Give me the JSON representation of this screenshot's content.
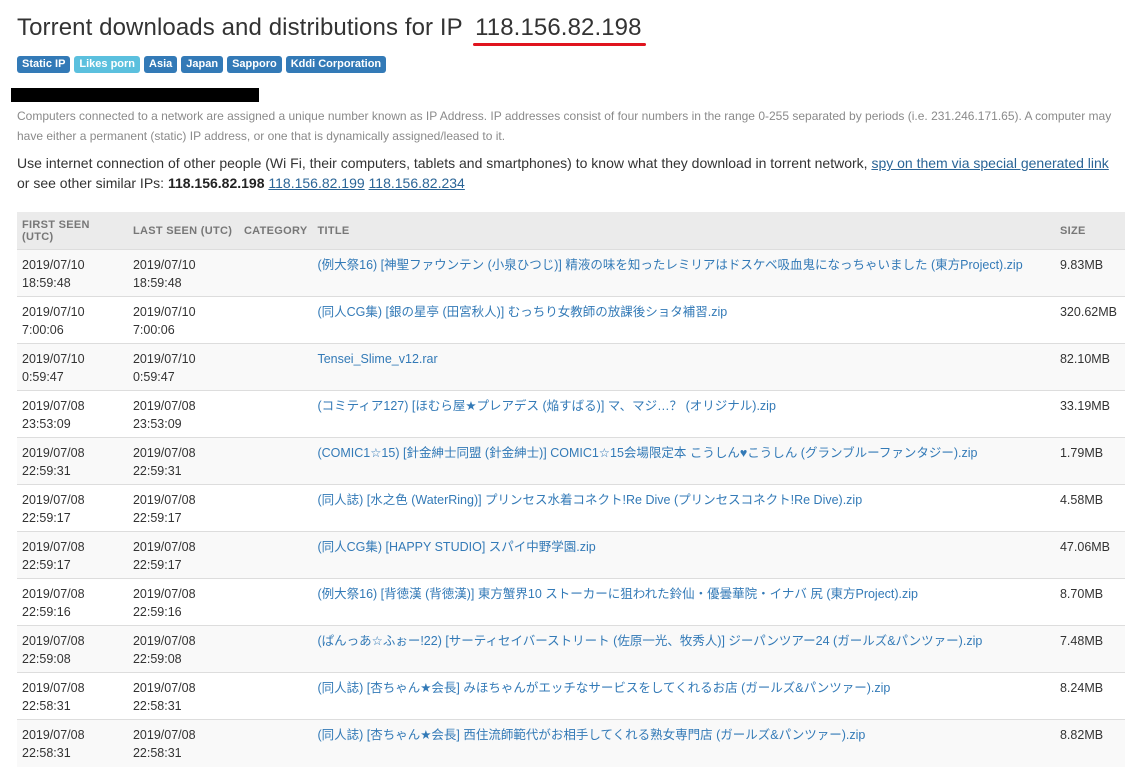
{
  "header": {
    "title_prefix": "Torrent downloads and distributions for IP",
    "ip": "118.156.82.198"
  },
  "tags": [
    {
      "label": "Static IP",
      "style": "primary"
    },
    {
      "label": "Likes porn",
      "style": "light"
    },
    {
      "label": "Asia",
      "style": "primary"
    },
    {
      "label": "Japan",
      "style": "primary"
    },
    {
      "label": "Sapporo",
      "style": "primary"
    },
    {
      "label": "Kddi Corporation",
      "style": "primary"
    }
  ],
  "note": "Computers connected to a network are assigned a unique number known as IP Address. IP addresses consist of four numbers in the range 0-255 separated by periods (i.e. 231.246.171.65). A computer may have either a permanent (static) IP address, or one that is dynamically assigned/leased to it.",
  "intro": {
    "text1": "Use internet connection of other people (Wi Fi, their computers, tablets and smartphones) to know what they download in torrent network, ",
    "spy_link": "spy on them via special generated link",
    "text2": "or see other similar IPs: ",
    "current_ip": "118.156.82.198",
    "similar_ips": [
      "118.156.82.199",
      "118.156.82.234"
    ]
  },
  "table": {
    "headers": [
      "First seen (UTC)",
      "Last seen (UTC)",
      "Category",
      "Title",
      "Size"
    ],
    "rows": [
      {
        "first": "2019/07/10 18:59:48",
        "last": "2019/07/10 18:59:48",
        "category": "",
        "title": "(例大祭16) [神聖ファウンテン (小泉ひつじ)] 精液の味を知ったレミリアはドスケベ吸血鬼になっちゃいました (東方Project).zip",
        "size": "9.83MB"
      },
      {
        "first": "2019/07/10 7:00:06",
        "last": "2019/07/10 7:00:06",
        "category": "",
        "title": "(同人CG集) [銀の星亭 (田宮秋人)] むっちり女教師の放課後ショタ補習.zip",
        "size": "320.62MB"
      },
      {
        "first": "2019/07/10 0:59:47",
        "last": "2019/07/10 0:59:47",
        "category": "",
        "title": "Tensei_Slime_v12.rar",
        "size": "82.10MB"
      },
      {
        "first": "2019/07/08 23:53:09",
        "last": "2019/07/08 23:53:09",
        "category": "",
        "title": "(コミティア127) [ほむら屋★プレアデス (焔すばる)] マ、マジ…？ (オリジナル).zip",
        "size": "33.19MB"
      },
      {
        "first": "2019/07/08 22:59:31",
        "last": "2019/07/08 22:59:31",
        "category": "",
        "title": "(COMIC1☆15) [針金紳士同盟 (針金紳士)] COMIC1☆15会場限定本 こうしん♥こうしん (グランブルーファンタジー).zip",
        "size": "1.79MB"
      },
      {
        "first": "2019/07/08 22:59:17",
        "last": "2019/07/08 22:59:17",
        "category": "",
        "title": "(同人誌) [水之色 (WaterRing)] プリンセス水着コネクト!Re Dive (プリンセスコネクト!Re Dive).zip",
        "size": "4.58MB"
      },
      {
        "first": "2019/07/08 22:59:17",
        "last": "2019/07/08 22:59:17",
        "category": "",
        "title": "(同人CG集) [HAPPY STUDIO] スパイ中野学園.zip",
        "size": "47.06MB"
      },
      {
        "first": "2019/07/08 22:59:16",
        "last": "2019/07/08 22:59:16",
        "category": "",
        "title": "(例大祭16) [背徳漢 (背徳漢)] 東方蟹界10 ストーカーに狙われた鈴仙・優曇華院・イナバ 尻 (東方Project).zip",
        "size": "8.70MB"
      },
      {
        "first": "2019/07/08 22:59:08",
        "last": "2019/07/08 22:59:08",
        "category": "",
        "title": "(ぱんっあ☆ふぉー!22) [サーティセイバーストリート (佐原一光、牧秀人)] ジーパンツアー24 (ガールズ&パンツァー).zip",
        "size": "7.48MB"
      },
      {
        "first": "2019/07/08 22:58:31",
        "last": "2019/07/08 22:58:31",
        "category": "",
        "title": "(同人誌) [杏ちゃん★会長] みほちゃんがエッチなサービスをしてくれるお店 (ガールズ&パンツァー).zip",
        "size": "8.24MB"
      },
      {
        "first": "2019/07/08 22:58:31",
        "last": "2019/07/08 22:58:31",
        "category": "",
        "title": "(同人誌) [杏ちゃん★会長] 西住流師範代がお相手してくれる熟女専門店 (ガールズ&パンツァー).zip",
        "size": "8.82MB"
      }
    ]
  }
}
